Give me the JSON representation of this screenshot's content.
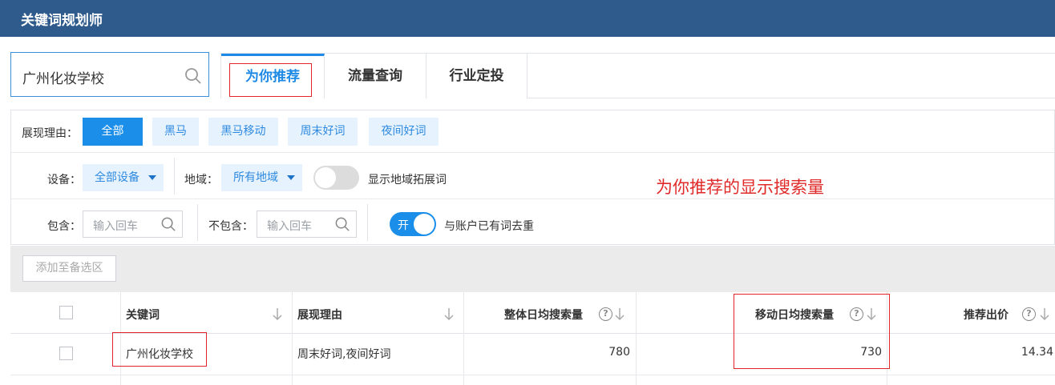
{
  "app": {
    "title": "关键词规划师"
  },
  "search": {
    "value": "广州化妆学校",
    "icon": "search-icon"
  },
  "tabs": [
    {
      "label": "为你推荐",
      "active": true
    },
    {
      "label": "流量查询",
      "active": false
    },
    {
      "label": "行业定投",
      "active": false
    }
  ],
  "filters": {
    "reason_label": "展现理由：",
    "reasons": [
      "全部",
      "黑马",
      "黑马移动",
      "周末好词",
      "夜间好词"
    ],
    "device_label": "设备：",
    "device_value": "全部设备",
    "region_label": "地域：",
    "region_value": "所有地域",
    "region_expand_label": "显示地域拓展词",
    "region_expand_on": false,
    "include_label": "包含：",
    "include_placeholder": "输入回车",
    "exclude_label": "不包含：",
    "exclude_placeholder": "输入回车",
    "dedupe_toggle_text": "开",
    "dedupe_on": true,
    "dedupe_label": "与账户已有词去重"
  },
  "toolbar": {
    "add_label": "添加至备选区"
  },
  "table": {
    "columns": [
      "关键词",
      "展现理由",
      "整体日均搜索量",
      "移动日均搜索量",
      "推荐出价"
    ],
    "help_glyph": "?",
    "rows": [
      {
        "keyword": "广州化妆学校",
        "reason": "周末好词,夜间好词",
        "total": "780",
        "mobile": "730",
        "bid": "14.34"
      }
    ]
  },
  "annotation": {
    "text": "为你推荐的显示搜索量",
    "color": "#e02a2a"
  },
  "colors": {
    "header": "#2f5b8c",
    "accent": "#1a8ee8",
    "chip_bg": "#e6f2fd",
    "highlight": "#e0252b"
  }
}
